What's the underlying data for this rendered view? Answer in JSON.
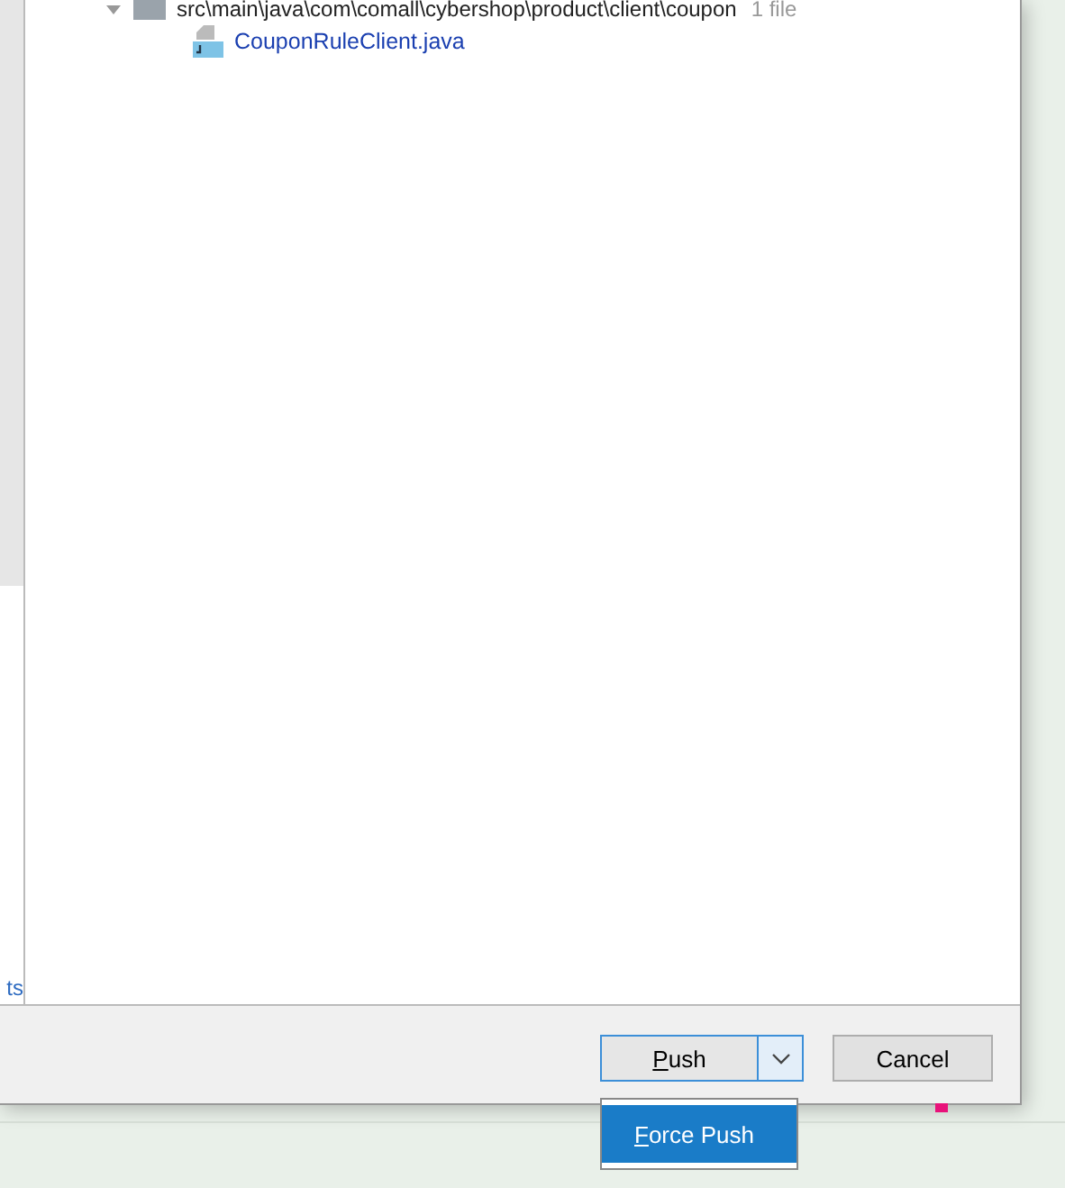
{
  "tree": {
    "folder": {
      "path": "src\\main\\java\\com\\comall\\cybershop\\product\\client\\coupon",
      "count": "1 file",
      "expanded": true
    },
    "files": [
      {
        "name": "CouponRuleClient.java"
      }
    ]
  },
  "left_panel": {
    "cut_text": "ts"
  },
  "buttons": {
    "push": "Push",
    "cancel": "Cancel"
  },
  "dropdown": {
    "items": [
      {
        "label": "Force Push",
        "selected": true
      }
    ]
  }
}
